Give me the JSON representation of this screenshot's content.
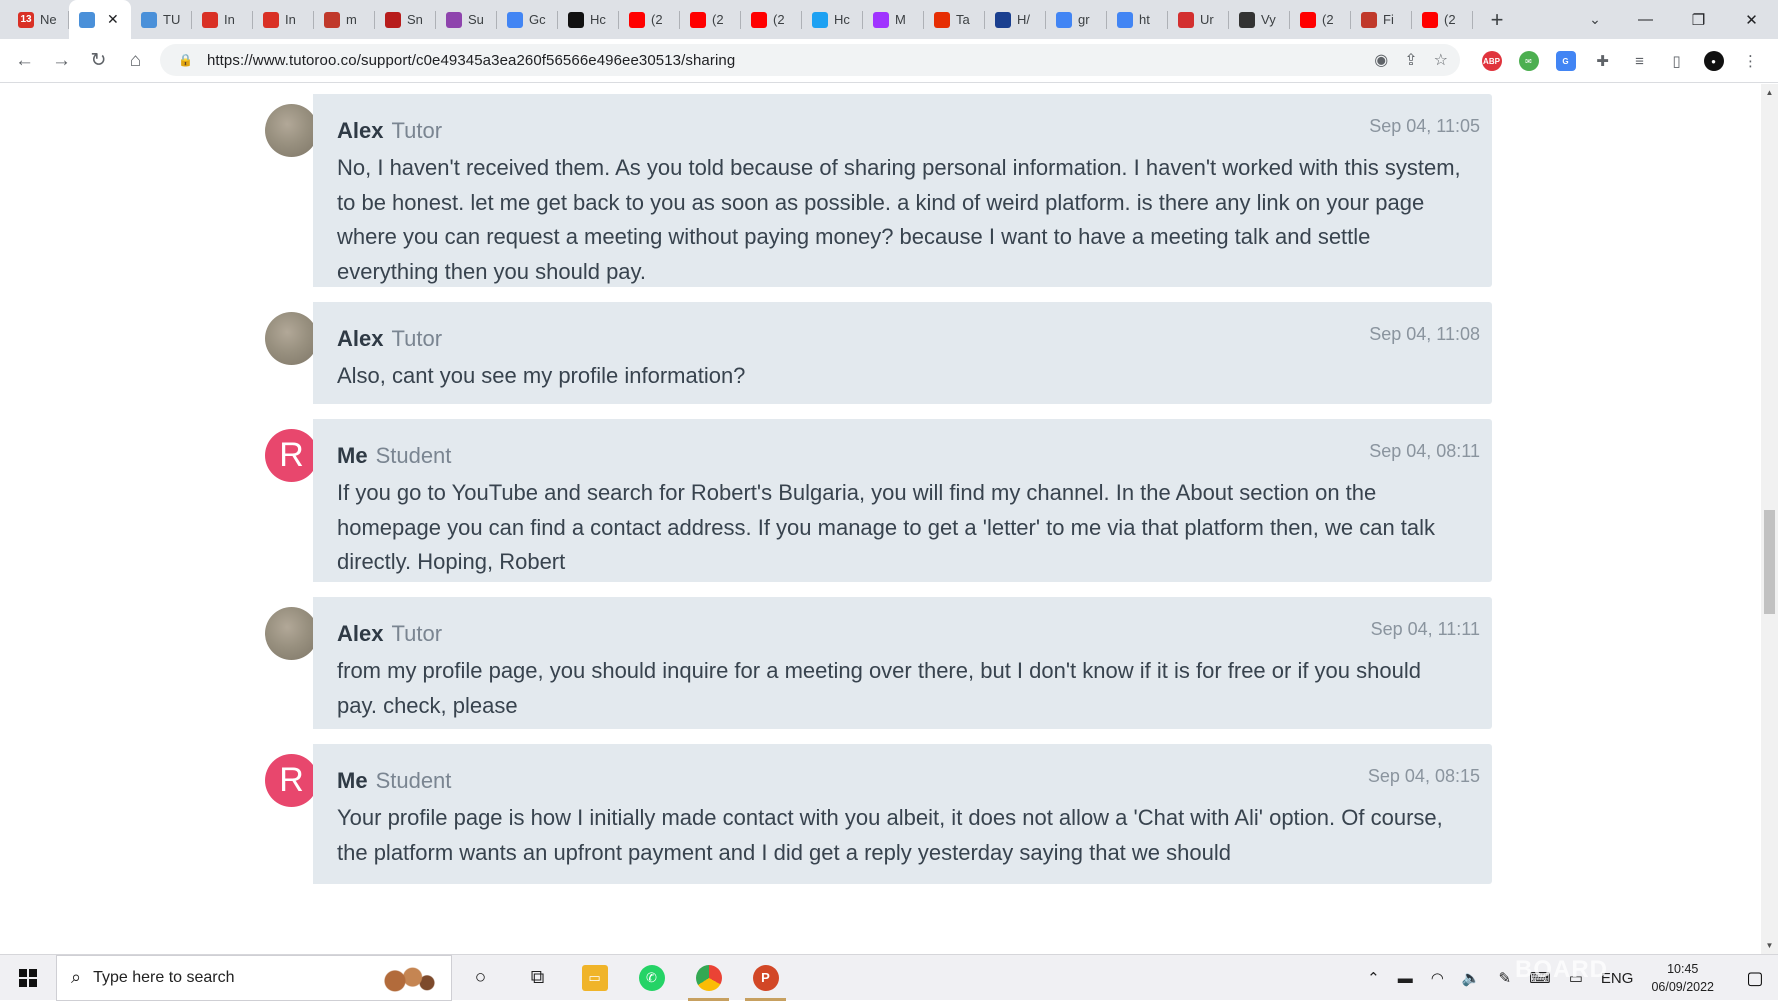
{
  "browser": {
    "tabs": [
      {
        "label": "Ne",
        "icon": "gmail-icon",
        "badge": "13",
        "color": "#d93025"
      },
      {
        "label": "",
        "icon": "tutoroo-icon",
        "color": "#4a90d9",
        "active": true
      },
      {
        "label": "TU",
        "icon": "tutoroo-icon",
        "color": "#4a90d9"
      },
      {
        "label": "In",
        "icon": "gmail-icon",
        "color": "#d93025"
      },
      {
        "label": "In",
        "icon": "gmail-icon",
        "color": "#d93025"
      },
      {
        "label": "m",
        "icon": "tumblr-icon",
        "color": "#c0392b"
      },
      {
        "label": "Sn",
        "icon": "snopes-icon",
        "color": "#b71c1c"
      },
      {
        "label": "Su",
        "icon": "dots-icon",
        "color": "#8e44ad"
      },
      {
        "label": "Gc",
        "icon": "google-translate-icon",
        "color": "#4285f4"
      },
      {
        "label": "Hc",
        "icon": "film-icon",
        "color": "#111111"
      },
      {
        "label": "(2",
        "icon": "youtube-icon",
        "color": "#ff0000"
      },
      {
        "label": "(2",
        "icon": "youtube-icon",
        "color": "#ff0000"
      },
      {
        "label": "(2",
        "icon": "youtube-icon",
        "color": "#ff0000"
      },
      {
        "label": "Hc",
        "icon": "twitter-icon",
        "color": "#1da1f2"
      },
      {
        "label": "M",
        "icon": "messenger-icon",
        "color": "#a033ff"
      },
      {
        "label": "Ta",
        "icon": "aliexpress-icon",
        "color": "#e62e04"
      },
      {
        "label": "H/",
        "icon": "feather-icon",
        "color": "#1a3f8f"
      },
      {
        "label": "gr",
        "icon": "google-icon",
        "color": "#4285f4"
      },
      {
        "label": "ht",
        "icon": "google-icon",
        "color": "#4285f4"
      },
      {
        "label": "Ur",
        "icon": "acrobat-icon",
        "color": "#d32f2f"
      },
      {
        "label": "Vy",
        "icon": "wikipedia-icon",
        "color": "#333333"
      },
      {
        "label": "(2",
        "icon": "youtube-icon",
        "color": "#ff0000"
      },
      {
        "label": "Fi",
        "icon": "shield-icon",
        "color": "#c0392b"
      },
      {
        "label": "(2",
        "icon": "youtube-icon",
        "color": "#ff0000"
      }
    ],
    "close_symbol": "✕",
    "new_tab_symbol": "+",
    "url": "https://www.tutoroo.co/support/c0e49345a3ea260f56566e496ee30513/sharing"
  },
  "conversation": {
    "messages": [
      {
        "name": "Alex",
        "role": "Tutor",
        "time": "Sep 04, 11:05",
        "avatar": "photo",
        "text": "No, I haven't received them. As you told because of sharing personal information. I haven't worked with this system, to be honest. let me get back to you as soon as possible. a kind of weird platform. is there any link on your page where you can request a meeting without paying money? because I want to have a meeting talk and settle everything then you should pay."
      },
      {
        "name": "Alex",
        "role": "Tutor",
        "time": "Sep 04, 11:08",
        "avatar": "photo",
        "text": "Also, cant you see my profile information?"
      },
      {
        "name": "Me",
        "role": "Student",
        "time": "Sep 04, 08:11",
        "avatar": "letter",
        "avatar_letter": "R",
        "text": "If you go to YouTube and search for Robert's Bulgaria, you will find my channel. In the About section on the homepage you can find a contact address. If you manage to get a 'letter' to me via that platform then, we can talk directly. Hoping, Robert"
      },
      {
        "name": "Alex",
        "role": "Tutor",
        "time": "Sep 04, 11:11",
        "avatar": "photo",
        "text": "from my profile page, you should inquire for a meeting over there, but I don't know if it is for free or if you should pay. check, please"
      },
      {
        "name": "Me",
        "role": "Student",
        "time": "Sep 04, 08:15",
        "avatar": "letter",
        "avatar_letter": "R",
        "text": "Your profile page is how I initially made contact with you albeit, it does not allow a 'Chat with Ali' option. Of course, the platform wants an upfront payment and I did get a reply yesterday saying that we should"
      }
    ]
  },
  "taskbar": {
    "search_placeholder": "Type here to search",
    "language": "ENG",
    "time": "10:45",
    "date": "06/09/2022",
    "watermark": "BOARD"
  },
  "colors": {
    "accent_student": "#e8476d",
    "bubble_bg": "#e3e9ee"
  }
}
